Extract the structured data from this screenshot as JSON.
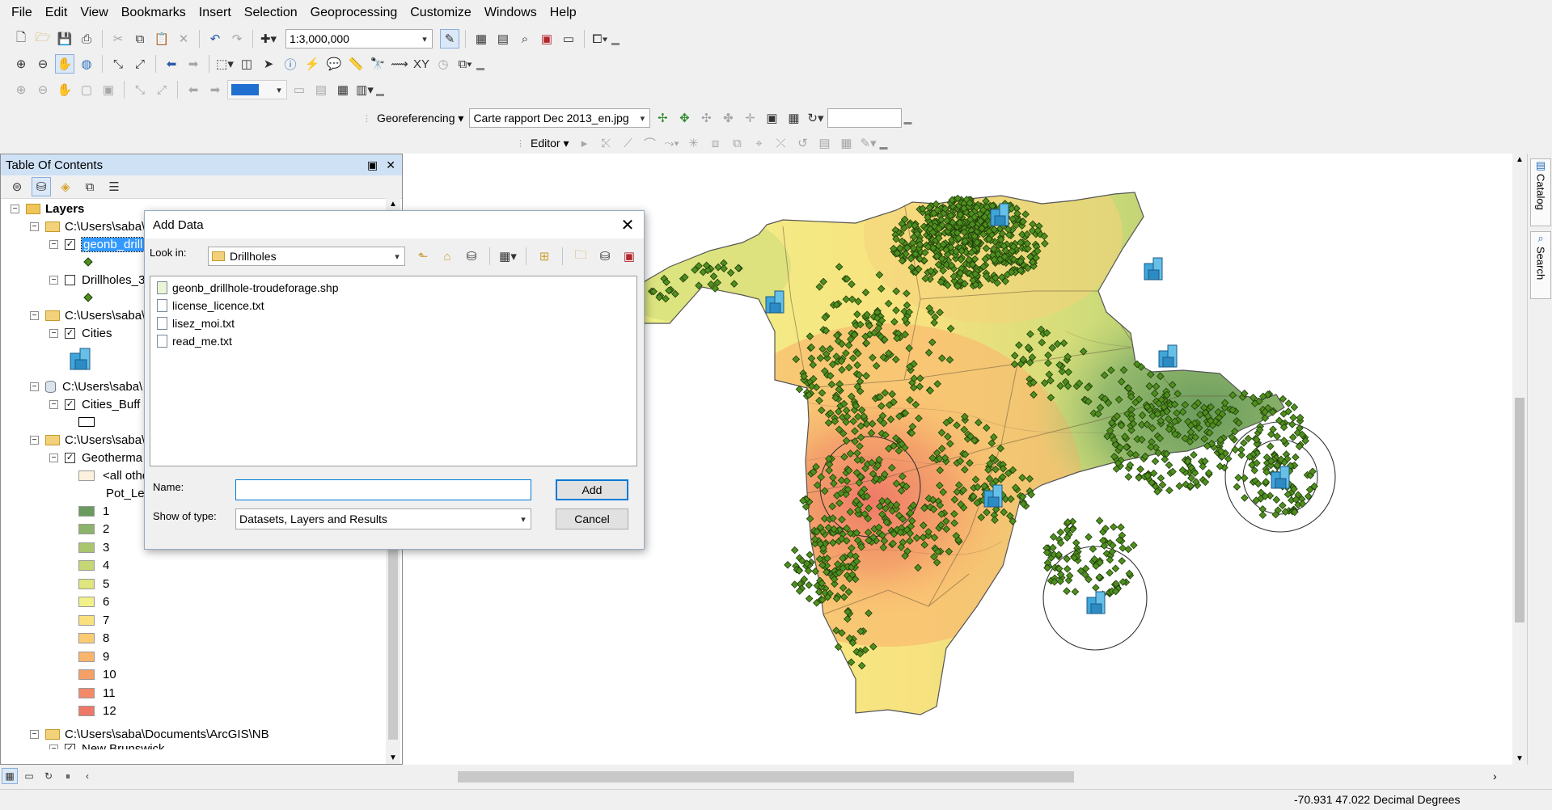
{
  "menu": [
    "File",
    "Edit",
    "View",
    "Bookmarks",
    "Insert",
    "Selection",
    "Geoprocessing",
    "Customize",
    "Windows",
    "Help"
  ],
  "standard_toolbar": {
    "scale_value": "1:3,000,000",
    "icons": [
      "new-document-icon",
      "open-folder-icon",
      "save-icon",
      "print-icon",
      "cut-icon",
      "copy-icon",
      "paste-icon",
      "delete-icon",
      "undo-icon",
      "redo-icon",
      "add-data-icon"
    ]
  },
  "georef_toolbar": {
    "label": "Georeferencing",
    "raster": "Carte rapport Dec 2013_en.jpg"
  },
  "editor_toolbar": {
    "label": "Editor"
  },
  "toc": {
    "title": "Table Of Contents",
    "rows": [
      {
        "kind": "group",
        "label": "Layers"
      },
      {
        "kind": "folder",
        "label": "C:\\Users\\saba\\"
      },
      {
        "kind": "layer",
        "label": "geonb_drill",
        "checked": true,
        "selected": true
      },
      {
        "kind": "layer",
        "label": "Drillholes_3",
        "checked": false
      },
      {
        "kind": "folder",
        "label": "C:\\Users\\saba\\"
      },
      {
        "kind": "layer",
        "label": "Cities",
        "checked": true
      },
      {
        "kind": "folder",
        "label": "C:\\Users\\saba\\"
      },
      {
        "kind": "layer",
        "label": "Cities_Buff",
        "checked": true
      },
      {
        "kind": "folder",
        "label": "C:\\Users\\saba\\"
      },
      {
        "kind": "layer",
        "label": "Geotherma",
        "checked": true
      },
      {
        "kind": "legend",
        "label": "<all othe"
      },
      {
        "kind": "legend-heading",
        "label": "Pot_Lev"
      }
    ],
    "classes": [
      {
        "label": "1",
        "color": "#6a9b5e"
      },
      {
        "label": "2",
        "color": "#8bb46a"
      },
      {
        "label": "3",
        "color": "#a9c66e"
      },
      {
        "label": "4",
        "color": "#c5d675"
      },
      {
        "label": "5",
        "color": "#dfe67d"
      },
      {
        "label": "6",
        "color": "#f2f08a"
      },
      {
        "label": "7",
        "color": "#fbe07e"
      },
      {
        "label": "8",
        "color": "#fbcb72"
      },
      {
        "label": "9",
        "color": "#f9b56b"
      },
      {
        "label": "10",
        "color": "#f6a068"
      },
      {
        "label": "11",
        "color": "#f28a68"
      },
      {
        "label": "12",
        "color": "#ee7868"
      }
    ],
    "footer_folder": "C:\\Users\\saba\\Documents\\ArcGIS\\NB",
    "footer_layer": "New Brunswick"
  },
  "dialog": {
    "title": "Add Data",
    "look_in_label": "Look in:",
    "look_in_value": "Drillholes",
    "files": [
      "geonb_drillhole-troudeforage.shp",
      "license_licence.txt",
      "lisez_moi.txt",
      "read_me.txt"
    ],
    "name_label": "Name:",
    "name_value": "",
    "type_label": "Show of type:",
    "type_value": "Datasets, Layers and Results",
    "add_label": "Add",
    "cancel_label": "Cancel"
  },
  "side_tabs": [
    "Catalog",
    "Search"
  ],
  "status": {
    "coords": "-70.931  47.022 Decimal Degrees"
  },
  "colors": {
    "selection": "#3399ff",
    "toc_title": "#cfe1f5",
    "point": "#4f8f1e"
  }
}
